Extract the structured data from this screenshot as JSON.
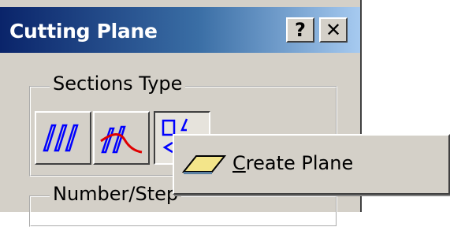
{
  "window": {
    "title": "Cutting Plane",
    "help_label": "?",
    "close_label": "✕"
  },
  "sections_type": {
    "label": "Sections Type",
    "buttons": [
      {
        "icon": "parallel-planes-icon"
      },
      {
        "icon": "normal-planes-icon"
      },
      {
        "icon": "planes-between-icon",
        "pressed": true
      }
    ]
  },
  "number_step": {
    "label": "Number/Step"
  },
  "context_menu": {
    "items": [
      {
        "mnemonic": "C",
        "rest": "reate Plane",
        "icon": "plane-icon"
      }
    ]
  },
  "colors": {
    "title_gradient_start": "#0a246a",
    "title_gradient_end": "#a6caf0",
    "dialog_background": "#d4d0c8",
    "icon_blue": "#0000ff",
    "icon_red": "#e00000",
    "plane_fill": "#f3e58a"
  }
}
